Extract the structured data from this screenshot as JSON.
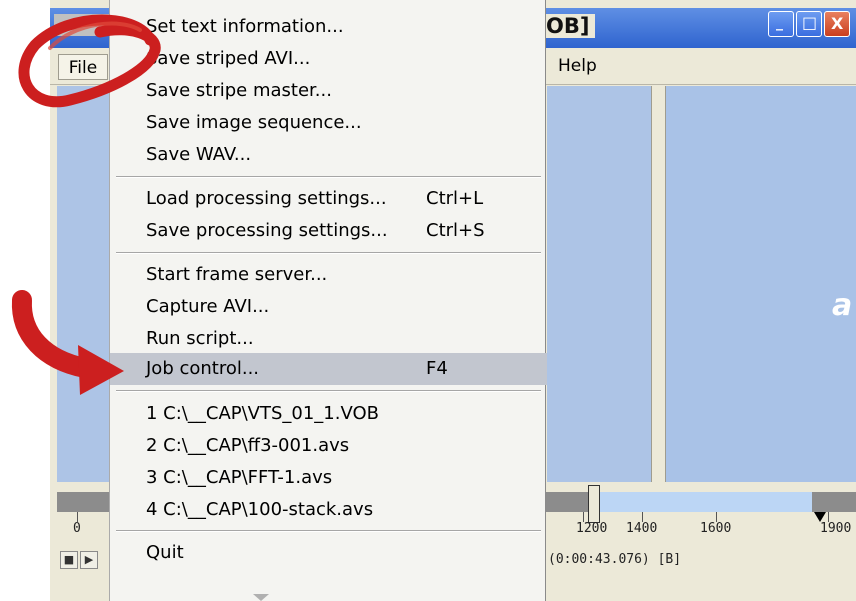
{
  "window": {
    "title_fragment": "OB]",
    "menubar": {
      "file": "File",
      "help": "Help"
    },
    "controls": {
      "minimize": "_",
      "maximize": "□",
      "close": "X"
    }
  },
  "file_menu": {
    "items": [
      {
        "label": "Set text information..."
      },
      {
        "label": "Save striped AVI..."
      },
      {
        "label": "Save stripe master..."
      },
      {
        "label": "Save image sequence..."
      },
      {
        "label": "Save WAV..."
      },
      {
        "label": "Load processing settings...",
        "shortcut": "Ctrl+L"
      },
      {
        "label": "Save processing settings...",
        "shortcut": "Ctrl+S"
      },
      {
        "label": "Start frame server..."
      },
      {
        "label": "Capture AVI..."
      },
      {
        "label": "Run script..."
      },
      {
        "label": "Job control...",
        "shortcut": "F4",
        "highlighted": true
      },
      {
        "label": "1 C:\\__CAP\\VTS_01_1.VOB"
      },
      {
        "label": "2 C:\\__CAP\\ff3-001.avs"
      },
      {
        "label": "3 C:\\__CAP\\FFT-1.avs"
      },
      {
        "label": "4 C:\\__CAP\\100-stack.avs"
      },
      {
        "label": "Quit"
      }
    ]
  },
  "timeline": {
    "ticks": [
      "0",
      "1200",
      "1400",
      "1600",
      "1900"
    ],
    "status": "(0:00:43.076) [B]"
  },
  "preview": {
    "partial_char": "a"
  },
  "colors": {
    "highlight": "#c2c6cf",
    "annotation": "#cc1f1f",
    "pane": "#adc4e6"
  }
}
